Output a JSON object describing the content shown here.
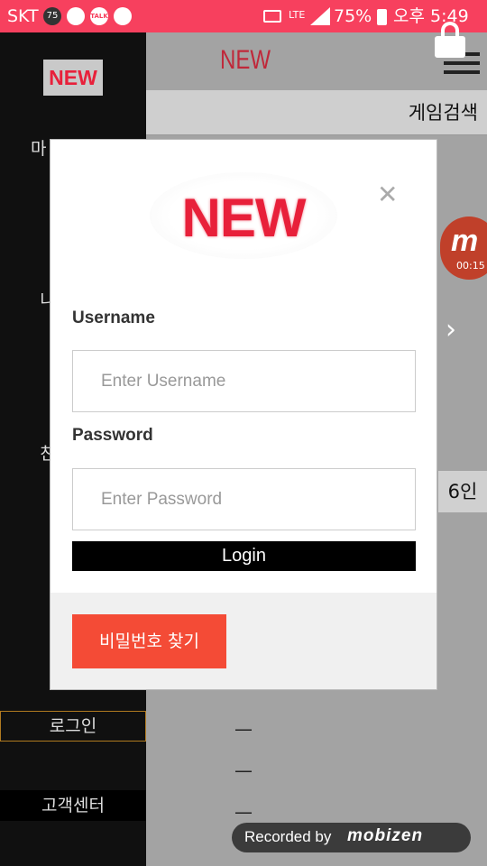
{
  "status_bar": {
    "carrier": "SKT",
    "badge": "75",
    "talk_label": "TALK",
    "network": "LTE",
    "battery": "75%",
    "time": "오후 5:49"
  },
  "background_app": {
    "header_logo": "NEW",
    "sidebar_logo": "NEW",
    "search_label": "게임검색",
    "player_count": "6인",
    "sidebar_login": "로그인",
    "sidebar_support": "고객센터",
    "sidebar_partial_1": "마",
    "sidebar_partial_2": "니",
    "sidebar_partial_3": "친",
    "list_dashes": [
      "—",
      "—",
      "—",
      "—"
    ],
    "next_arrow": "›"
  },
  "recorder": {
    "timer": "00:15",
    "recorded_by": "Recorded by",
    "brand": "mobizen"
  },
  "modal": {
    "logo": "NEW",
    "close_symbol": "✕",
    "username_label": "Username",
    "username_placeholder": "Enter Username",
    "password_label": "Password",
    "password_placeholder": "Enter Password",
    "login_button": "Login",
    "find_password_button": "비밀번호 찾기"
  },
  "colors": {
    "status_bar": "#f7405e",
    "logo_red": "#e8203a",
    "find_button": "#f44b36",
    "login_bg": "#000000"
  }
}
